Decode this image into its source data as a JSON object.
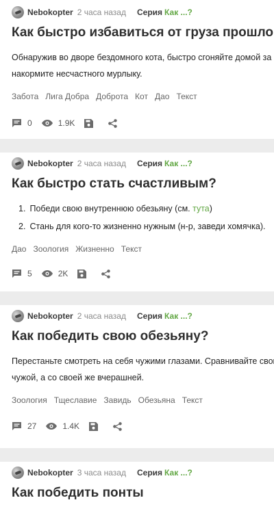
{
  "posts": [
    {
      "author": "Nebokopter",
      "time": "2 часа назад",
      "series_label": "Серия",
      "series_link": "Как ...?",
      "title": "Как быстро избавиться от груза прошлого?",
      "body_line1": "Обнаружив во дворе бездомного кота, быстро сгоняйте домой за хом",
      "body_line2": "накормите несчастного мурлыку.",
      "tags": [
        "Забота",
        "Лига Добра",
        "Доброта",
        "Кот",
        "Дао",
        "Текст"
      ],
      "comments": "0",
      "views": "1.9K",
      "icons": [
        "comment-icon",
        "eye-icon",
        "save-icon",
        "share-icon",
        "link-icon"
      ]
    },
    {
      "author": "Nebokopter",
      "time": "2 часа назад",
      "series_label": "Серия",
      "series_link": "Как ...?",
      "title": "Как быстро стать счастливым?",
      "list": [
        {
          "num": "1.",
          "text": "Победи свою внутреннюю обезьяну (см. ",
          "link": "тута",
          "after": ")"
        },
        {
          "num": "2.",
          "text": "Стань для кого-то жизненно нужным (н-р, заведи хомячка)."
        }
      ],
      "tags": [
        "Дао",
        "Зоология",
        "Жизненно",
        "Текст"
      ],
      "comments": "5",
      "views": "2K"
    },
    {
      "author": "Nebokopter",
      "time": "2 часа назад",
      "series_label": "Серия",
      "series_link": "Как ...?",
      "title": "Как победить свою обезьяну?",
      "body_line1": "Перестаньте смотреть на себя чужими глазами. Сравнивайте свою со",
      "body_line2": "чужой, а со своей же вчерашней.",
      "tags": [
        "Зоология",
        "Тщеславие",
        "Завидь",
        "Обезьяна",
        "Текст"
      ],
      "comments": "27",
      "views": "1.4K"
    },
    {
      "author": "Nebokopter",
      "time": "3 часа назад",
      "series_label": "Серия",
      "series_link": "Как ...?",
      "title": "Как победить понты"
    }
  ],
  "colors": {
    "accent": "#62a744",
    "background": "#ececec",
    "card": "#ffffff",
    "icon": "#6b6b6b"
  }
}
